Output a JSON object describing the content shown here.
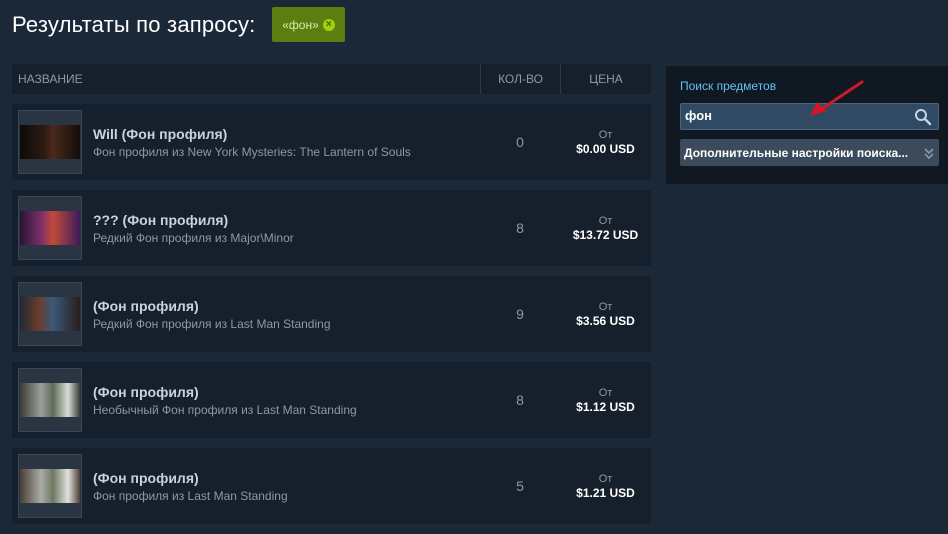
{
  "header": {
    "title": "Результаты по запросу:",
    "query_tag": "«фон»",
    "remove_symbol": "×"
  },
  "table": {
    "columns": {
      "name": "НАЗВАНИЕ",
      "qty": "КОЛ-ВО",
      "price": "ЦЕНА"
    },
    "rows": [
      {
        "name": "Will (Фон профиля)",
        "game": "Фон профиля из New York Mysteries: The Lantern of Souls",
        "qty": "0",
        "price_prefix": "От",
        "price": "$0.00 USD",
        "thumb_color": "#2b1a12"
      },
      {
        "name": "??? (Фон профиля)",
        "game": "Редкий Фон профиля из Major\\Minor",
        "qty": "8",
        "price_prefix": "От",
        "price": "$13.72 USD",
        "thumb_color": "#5a2a6e"
      },
      {
        "name": "(Фон профиля)",
        "game": "Редкий Фон профиля из Last Man Standing",
        "qty": "9",
        "price_prefix": "От",
        "price": "$3.56 USD",
        "thumb_color": "#3c3e46"
      },
      {
        "name": "(Фон профиля)",
        "game": "Необычный Фон профиля из Last Man Standing",
        "qty": "8",
        "price_prefix": "От",
        "price": "$1.12 USD",
        "thumb_color": "#7a8478"
      },
      {
        "name": "(Фон профиля)",
        "game": "Фон профиля из Last Man Standing",
        "qty": "5",
        "price_prefix": "От",
        "price": "$1.21 USD",
        "thumb_color": "#8a8f88"
      }
    ]
  },
  "sidebar": {
    "label": "Поиск предметов",
    "search_value": "фон",
    "advanced_label": "Дополнительные настройки поиска..."
  },
  "colors": {
    "accent_link": "#66c0f4",
    "tag_green": "#5c7e10",
    "annotation_arrow": "#d0182a"
  }
}
